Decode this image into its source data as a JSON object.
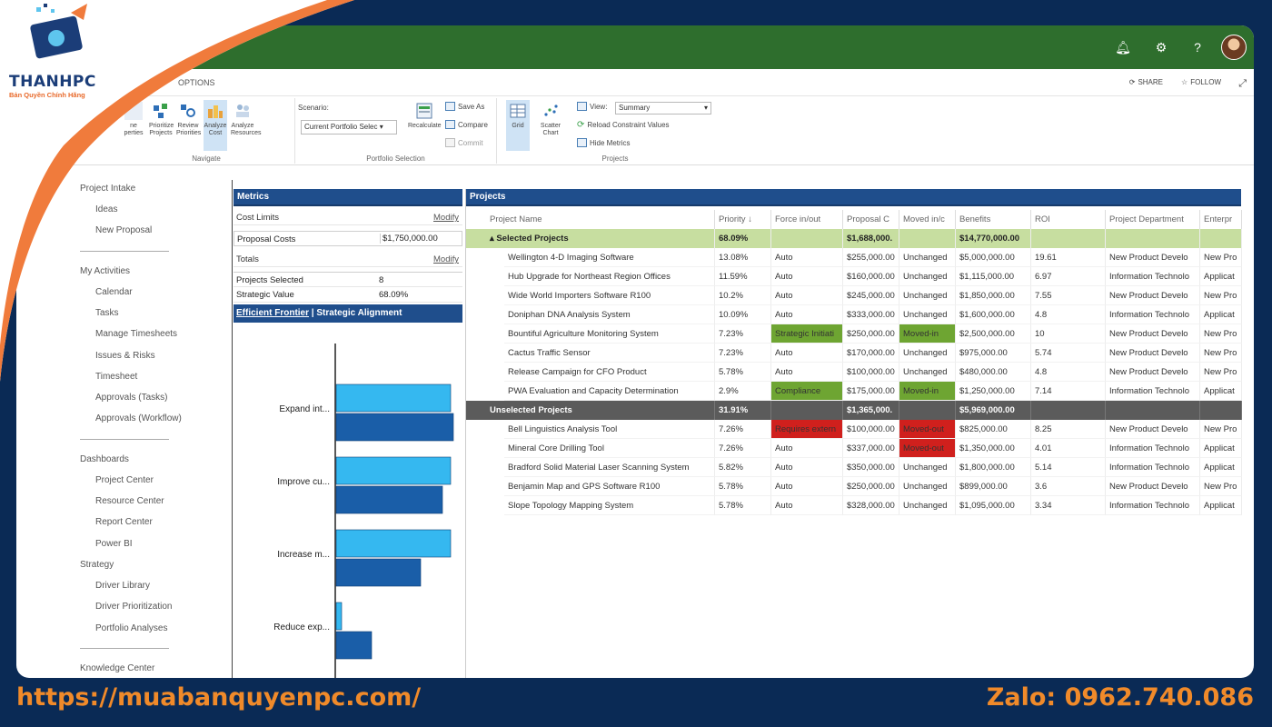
{
  "brand": {
    "name": "THANHPC",
    "tagline": "Bản Quyền Chính Hãng"
  },
  "footer": {
    "url": "https://muabanquyenpc.com/",
    "zalo": "Zalo: 0962.740.086"
  },
  "topbar": {
    "color": "#2e6e2d",
    "icons": [
      "bell-icon",
      "gear-icon",
      "help-icon",
      "user-avatar"
    ],
    "help_label": "?"
  },
  "ribbonbar": {
    "options_tab": "OPTIONS",
    "share": "SHARE",
    "follow": "FOLLOW"
  },
  "ribbon": {
    "navigate": {
      "label": "Navigate",
      "buttons": [
        {
          "label": "Define Properties",
          "partial": "ne\nperties"
        },
        {
          "label": "Prioritize\nProjects"
        },
        {
          "label": "Review\nPriorities"
        },
        {
          "label": "Analyze\nCost"
        },
        {
          "label": "Analyze\nResources"
        }
      ]
    },
    "portfolio": {
      "label": "Portfolio Selection",
      "scenario_label": "Scenario:",
      "scenario_value": "Current Portfolio Selec",
      "recalculate": "Recalculate",
      "save_as": "Save As",
      "compare": "Compare",
      "commit": "Commit"
    },
    "projects": {
      "label": "Projects",
      "grid": "Grid",
      "scatter": "Scatter\nChart",
      "view_label": "View:",
      "view_value": "Summary",
      "reload": "Reload Constraint Values",
      "hide": "Hide Metrics"
    }
  },
  "leftnav": {
    "groups": [
      {
        "head": "Project Intake",
        "items": [
          "Ideas",
          "New Proposal"
        ]
      },
      {
        "head": "My Activities",
        "items": [
          "Calendar",
          "Tasks",
          "Manage Timesheets",
          "Issues & Risks",
          "Timesheet",
          "Approvals (Tasks)",
          "Approvals (Workflow)"
        ]
      },
      {
        "head": "Dashboards",
        "items": [
          "Project Center",
          "Resource Center",
          "Report Center",
          "Power BI"
        ]
      },
      {
        "head": "Strategy",
        "items": [
          "Driver Library",
          "Driver Prioritization",
          "Portfolio Analyses"
        ]
      },
      {
        "head": "Knowledge Center",
        "items": []
      }
    ]
  },
  "metrics": {
    "title": "Metrics",
    "cost_limits": "Cost Limits",
    "modify": "Modify",
    "proposal_costs_label": "Proposal Costs",
    "proposal_costs_value": "$1,750,000.00",
    "totals": "Totals",
    "modify2": "Modify",
    "projects_selected_label": "Projects Selected",
    "projects_selected_value": "8",
    "strategic_value_label": "Strategic Value",
    "strategic_value_value": "68.09%",
    "tab_frontier": "Efficient Frontier",
    "tab_sep": "|",
    "tab_alignment": "Strategic Alignment"
  },
  "chart_data": {
    "type": "bar",
    "categories": [
      "Expand int...",
      "Improve cu...",
      "Increase m...",
      "Reduce exp..."
    ],
    "series": [
      {
        "values": [
          42,
          42,
          42,
          2
        ],
        "color": "#35b8f0"
      },
      {
        "values": [
          43,
          39,
          31,
          13
        ],
        "color": "#1a5ea8"
      }
    ]
  },
  "projects": {
    "title": "Projects",
    "columns": [
      "Project Name",
      "Priority ↓",
      "Force in/out",
      "Proposal C",
      "Moved in/c",
      "Benefits",
      "ROI",
      "Project Department",
      "Enterpr"
    ],
    "groups": [
      {
        "name": "Selected Projects",
        "priority": "68.09%",
        "proposal": "$1,688,000.",
        "benefits": "$14,770,000.00",
        "rows": [
          {
            "name": "Wellington 4-D Imaging Software",
            "priority": "13.08%",
            "force": "Auto",
            "proposal": "$255,000.00",
            "moved": "Unchanged",
            "benefits": "$5,000,000.00",
            "roi": "19.61",
            "dept": "New Product Develo",
            "ent": "New Pro"
          },
          {
            "name": "Hub Upgrade for Northeast Region Offices",
            "priority": "11.59%",
            "force": "Auto",
            "proposal": "$160,000.00",
            "moved": "Unchanged",
            "benefits": "$1,115,000.00",
            "roi": "6.97",
            "dept": "Information Technolo",
            "ent": "Applicat"
          },
          {
            "name": "Wide World Importers Software R100",
            "priority": "10.2%",
            "force": "Auto",
            "proposal": "$245,000.00",
            "moved": "Unchanged",
            "benefits": "$1,850,000.00",
            "roi": "7.55",
            "dept": "New Product Develo",
            "ent": "New Pro"
          },
          {
            "name": "Doniphan DNA Analysis System",
            "priority": "10.09%",
            "force": "Auto",
            "proposal": "$333,000.00",
            "moved": "Unchanged",
            "benefits": "$1,600,000.00",
            "roi": "4.8",
            "dept": "Information Technolo",
            "ent": "Applicat"
          },
          {
            "name": "Bountiful Agriculture Monitoring System",
            "priority": "7.23%",
            "force": "Strategic Initiati",
            "force_hl": "green",
            "proposal": "$250,000.00",
            "moved": "Moved-in",
            "moved_hl": "green",
            "benefits": "$2,500,000.00",
            "roi": "10",
            "dept": "New Product Develo",
            "ent": "New Pro"
          },
          {
            "name": "Cactus Traffic Sensor",
            "priority": "7.23%",
            "force": "Auto",
            "proposal": "$170,000.00",
            "moved": "Unchanged",
            "benefits": "$975,000.00",
            "roi": "5.74",
            "dept": "New Product Develo",
            "ent": "New Pro"
          },
          {
            "name": "Release Campaign for CFO Product",
            "priority": "5.78%",
            "force": "Auto",
            "proposal": "$100,000.00",
            "moved": "Unchanged",
            "benefits": "$480,000.00",
            "roi": "4.8",
            "dept": "New Product Develo",
            "ent": "New Pro"
          },
          {
            "name": "PWA Evaluation and Capacity Determination",
            "priority": "2.9%",
            "force": "Compliance",
            "force_hl": "green",
            "proposal": "$175,000.00",
            "moved": "Moved-in",
            "moved_hl": "green",
            "benefits": "$1,250,000.00",
            "roi": "7.14",
            "dept": "Information Technolo",
            "ent": "Applicat"
          }
        ]
      },
      {
        "name": "Unselected Projects",
        "priority": "31.91%",
        "proposal": "$1,365,000.",
        "benefits": "$5,969,000.00",
        "rows": [
          {
            "name": "Bell Linguistics Analysis Tool",
            "priority": "7.26%",
            "force": "Requires extern",
            "force_hl": "red",
            "proposal": "$100,000.00",
            "moved": "Moved-out",
            "moved_hl": "red",
            "benefits": "$825,000.00",
            "roi": "8.25",
            "dept": "New Product Develo",
            "ent": "New Pro"
          },
          {
            "name": "Mineral Core Drilling Tool",
            "priority": "7.26%",
            "force": "Auto",
            "proposal": "$337,000.00",
            "moved": "Moved-out",
            "moved_hl": "red",
            "benefits": "$1,350,000.00",
            "roi": "4.01",
            "dept": "Information Technolo",
            "ent": "Applicat"
          },
          {
            "name": "Bradford Solid Material Laser Scanning System",
            "priority": "5.82%",
            "force": "Auto",
            "proposal": "$350,000.00",
            "moved": "Unchanged",
            "benefits": "$1,800,000.00",
            "roi": "5.14",
            "dept": "Information Technolo",
            "ent": "Applicat"
          },
          {
            "name": "Benjamin Map and GPS Software R100",
            "priority": "5.78%",
            "force": "Auto",
            "proposal": "$250,000.00",
            "moved": "Unchanged",
            "benefits": "$899,000.00",
            "roi": "3.6",
            "dept": "New Product Develo",
            "ent": "New Pro"
          },
          {
            "name": "Slope Topology Mapping System",
            "priority": "5.78%",
            "force": "Auto",
            "proposal": "$328,000.00",
            "moved": "Unchanged",
            "benefits": "$1,095,000.00",
            "roi": "3.34",
            "dept": "Information Technolo",
            "ent": "Applicat"
          }
        ]
      }
    ]
  }
}
